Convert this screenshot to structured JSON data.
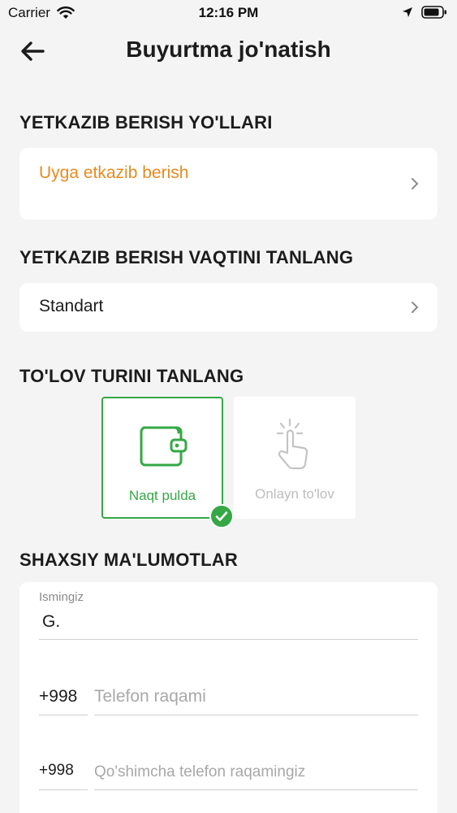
{
  "status_bar": {
    "carrier": "Carrier",
    "time": "12:16 PM"
  },
  "header": {
    "title": "Buyurtma jo'natish"
  },
  "delivery_method": {
    "section_title": "YETKAZIB BERISH YO'LLARI",
    "value": "Uyga etkazib berish",
    "accent_color": "#e88a1f"
  },
  "delivery_time": {
    "section_title": "YETKAZIB BERISH VAQTINI TANLANG",
    "value": "Standart"
  },
  "payment": {
    "section_title": "TO'LOV TURINI TANLANG",
    "options": [
      {
        "label": "Naqt pulda",
        "icon": "wallet-icon",
        "selected": true
      },
      {
        "label": "Onlayn to'lov",
        "icon": "tap-icon",
        "selected": false
      }
    ],
    "selected_color": "#35a845"
  },
  "personal": {
    "section_title": "SHAXSIY MA'LUMOTLAR",
    "name_label": "Ismingiz",
    "name_value": "G.",
    "phone_prefix": "+998",
    "phone_placeholder": "Telefon raqami",
    "phone2_prefix": "+998",
    "phone2_placeholder": "Qo'shimcha telefon raqamingiz"
  }
}
